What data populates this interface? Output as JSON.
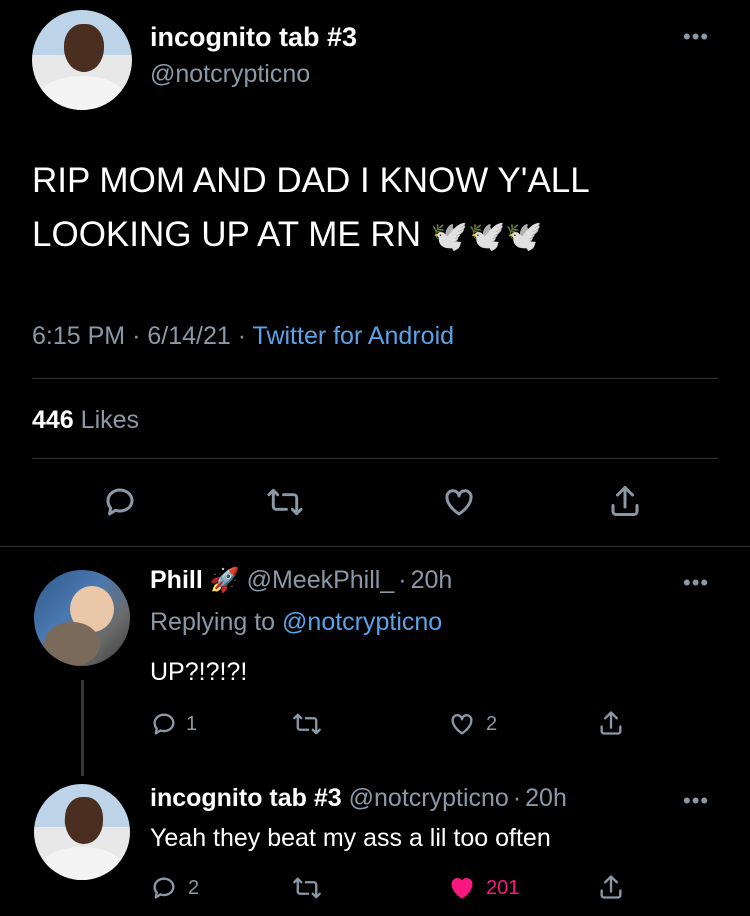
{
  "tweet": {
    "display_name": "incognito tab #3",
    "handle": "@notcrypticno",
    "text_line1": "RIP MOM AND DAD I KNOW Y'ALL",
    "text_line2": "LOOKING UP AT ME RN",
    "emoji": "🕊️🕊️🕊️",
    "time": "6:15 PM",
    "sep1": "·",
    "date": "6/14/21",
    "sep2": "·",
    "source": "Twitter for Android",
    "likes_count": "446",
    "likes_label": "Likes"
  },
  "reply1": {
    "display_name": "Phill",
    "name_emoji": "🚀",
    "handle": "@MeekPhill_",
    "sep": "·",
    "age": "20h",
    "replying_prefix": "Replying to",
    "replying_handle": "@notcrypticno",
    "text": "UP?!?!?!",
    "reply_count": "1",
    "like_count": "2"
  },
  "reply2": {
    "display_name": "incognito tab #3",
    "handle": "@notcrypticno",
    "sep": "·",
    "age": "20h",
    "text": "Yeah they beat my ass a lil too often",
    "reply_count": "2",
    "like_count": "201"
  },
  "colors": {
    "background": "#000000",
    "link": "#5aa3e8",
    "muted": "#8b98a5",
    "liked": "#f91880"
  },
  "icons": [
    "more-icon",
    "reply-icon",
    "retweet-icon",
    "like-icon",
    "share-icon",
    "liked-heart-icon"
  ]
}
